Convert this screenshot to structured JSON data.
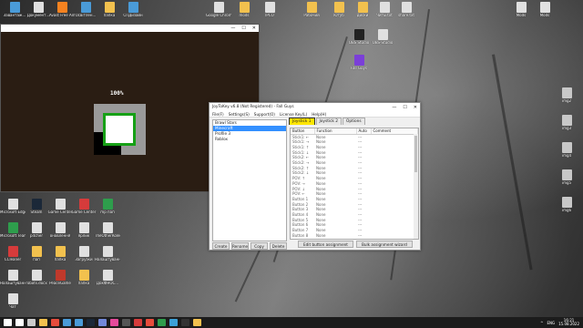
{
  "desktop_icons_top": [
    {
      "label": "Завантаж...",
      "color": "#4a9bd8"
    },
    {
      "label": "Документ...",
      "color": "#e0e0e0"
    },
    {
      "label": "Avast Free Antivirus",
      "color": "#f58220"
    },
    {
      "label": "Освітлен...",
      "color": "#4a9bd8"
    },
    {
      "label": "папка",
      "color": "#f2c14e"
    },
    {
      "label": "СПДизайн",
      "color": "#4a9bd8"
    }
  ],
  "desktop_icons_right": [
    {
      "label": "Mods",
      "color": "#e0e0e0"
    },
    {
      "label": "Mods",
      "color": "#e0e0e0"
    },
    {
      "label": "img2",
      "color": "#c8c8c8"
    },
    {
      "label": "img3",
      "color": "#c8c8c8"
    },
    {
      "label": "img4",
      "color": "#c8c8c8"
    },
    {
      "label": "img5",
      "color": "#c8c8c8"
    },
    {
      "label": "img6",
      "color": "#c8c8c8"
    }
  ],
  "desktop_icons_mid": [
    {
      "label": "Google Chrome",
      "color": "#e0e0e0"
    },
    {
      "label": "mods",
      "color": "#f2c14e"
    },
    {
      "label": "IPCO",
      "color": "#e0e0e0"
    },
    {
      "label": "Рабочий",
      "color": "#f2c14e"
    },
    {
      "label": "Ютуб",
      "color": "#f2c14e"
    },
    {
      "label": "диски",
      "color": "#f2c14e"
    },
    {
      "label": "Читы.txt",
      "color": "#e0e0e0"
    },
    {
      "label": "share.txt",
      "color": "#e0e0e0"
    },
    {
      "label": "OBS Studio",
      "color": "#222"
    },
    {
      "label": "OBS-Studio",
      "color": "#e0e0e0"
    },
    {
      "label": "Fall Guys",
      "color": "#7b3fd8"
    }
  ],
  "desktop_icons_left": [
    {
      "label": "Microsoft Edge",
      "color": "#e0e0e0"
    },
    {
      "label": "Steam",
      "color": "#1b2838"
    },
    {
      "label": "Game Center",
      "color": "#e0e0e0"
    },
    {
      "label": "Game Center",
      "color": "#d63b3b"
    },
    {
      "label": "mp пап",
      "color": "#2e9d4c"
    },
    {
      "label": "Microsoft Teams",
      "color": "#2e9d4c"
    },
    {
      "label": "pitcher",
      "color": "#e0e0e0"
    },
    {
      "label": "оновлення",
      "color": "#e0e0e0"
    },
    {
      "label": "ярлик",
      "color": "#e0e0e0"
    },
    {
      "label": "TheOtherRoles",
      "color": "#e0e0e0"
    },
    {
      "label": "CCleaner",
      "color": "#d63b3b"
    },
    {
      "label": "пап",
      "color": "#f2c14e"
    },
    {
      "label": "папка",
      "color": "#f2c14e"
    },
    {
      "label": "Загрузки",
      "color": "#e0e0e0"
    },
    {
      "label": "Налаштування...",
      "color": "#e0e0e0"
    },
    {
      "label": "Налаштування 17...",
      "color": "#e0e0e0"
    },
    {
      "label": "robots.docx",
      "color": "#e0e0e0"
    },
    {
      "label": "PeaceGame",
      "color": "#c0392b"
    },
    {
      "label": "папка",
      "color": "#f2c14e"
    },
    {
      "label": "ДокФНОС...",
      "color": "#e0e0e0"
    },
    {
      "label": "Чат",
      "color": "#e0e0e0"
    }
  ],
  "game_window": {
    "minimize": "—",
    "maximize": "☐",
    "close": "✕",
    "progress_text": "100%"
  },
  "joy_window": {
    "title": "JoyToKey v6.8 (Not Registered) - Fall Guys",
    "controls": [
      "—",
      "☐",
      "✕"
    ],
    "menu": [
      "File(F)",
      "Settings(S)",
      "Support(O)",
      "License Key(L)",
      "Help(H)"
    ],
    "profiles": [
      "Brawl Stars",
      "Minecraft",
      "Profile 3",
      "Roblox"
    ],
    "selected_profile_index": 1,
    "profile_buttons": [
      "Create",
      "Rename",
      "Copy",
      "Delete"
    ],
    "tabs": [
      "Joystick 1",
      "Joystick 2",
      "Options"
    ],
    "active_tab_index": 0,
    "columns": [
      "Button",
      "Function",
      "Auto",
      "Comment"
    ],
    "rows": [
      [
        "Stick1: ←",
        "None",
        "---"
      ],
      [
        "Stick1: →",
        "None",
        "---"
      ],
      [
        "Stick1: ↑",
        "None",
        "---"
      ],
      [
        "Stick1: ↓",
        "None",
        "---"
      ],
      [
        "Stick2: ←",
        "None",
        "---"
      ],
      [
        "Stick2: →",
        "None",
        "---"
      ],
      [
        "Stick2: ↑",
        "None",
        "---"
      ],
      [
        "Stick2: ↓",
        "None",
        "---"
      ],
      [
        "POV: ↑",
        "None",
        "---"
      ],
      [
        "POV: →",
        "None",
        "---"
      ],
      [
        "POV: ↓",
        "None",
        "---"
      ],
      [
        "POV: ←",
        "None",
        "---"
      ],
      [
        "Button 1",
        "None",
        "---"
      ],
      [
        "Button 2",
        "None",
        "---"
      ],
      [
        "Button 3",
        "None",
        "---"
      ],
      [
        "Button 4",
        "None",
        "---"
      ],
      [
        "Button 5",
        "None",
        "---"
      ],
      [
        "Button 6",
        "None",
        "---"
      ],
      [
        "Button 7",
        "None",
        "---"
      ],
      [
        "Button 8",
        "None",
        "---"
      ]
    ],
    "edit_button": "Edit button assignment",
    "bulk_button": "Bulk assignment wizard"
  },
  "taskbar": {
    "apps": [
      {
        "name": "start-icon",
        "color": "#ffffff"
      },
      {
        "name": "search-icon",
        "color": "#ffffff"
      },
      {
        "name": "taskview-icon",
        "color": "#cccccc"
      },
      {
        "name": "explorer-icon",
        "color": "#f2c14e"
      },
      {
        "name": "chrome-icon",
        "color": "#e74c3c"
      },
      {
        "name": "store-icon",
        "color": "#4a9bd8"
      },
      {
        "name": "mail-icon",
        "color": "#4a9bd8"
      },
      {
        "name": "steam-icon",
        "color": "#1b2838"
      },
      {
        "name": "discord-icon",
        "color": "#7289da"
      },
      {
        "name": "fallguys-icon",
        "color": "#e64a9b"
      },
      {
        "name": "obs-icon",
        "color": "#555555"
      },
      {
        "name": "game-icon",
        "color": "#d63b3b"
      },
      {
        "name": "opera-icon",
        "color": "#e74c3c"
      },
      {
        "name": "joy-icon",
        "color": "#2e9d4c"
      },
      {
        "name": "telegram-icon",
        "color": "#3ca1d8"
      },
      {
        "name": "epic-icon",
        "color": "#333333"
      },
      {
        "name": "note-icon",
        "color": "#f2c14e"
      }
    ],
    "lang": "ENG",
    "time": "16:21",
    "date": "15.08.2022"
  }
}
